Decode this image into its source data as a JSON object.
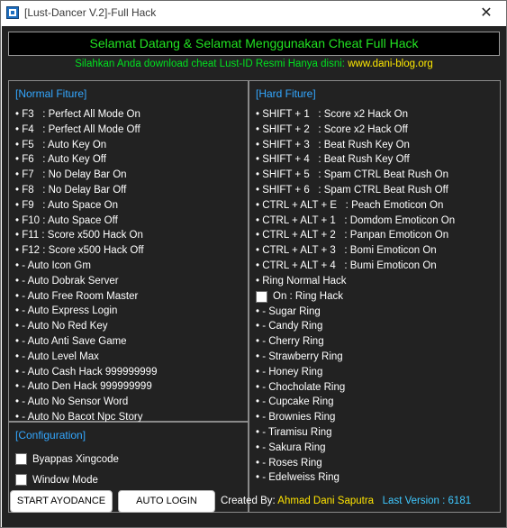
{
  "window": {
    "title": "[Lust-Dancer V.2]-Full Hack",
    "close_symbol": "✕"
  },
  "banner": {
    "text": "Selamat Datang & Selamat Menggunakan Cheat Full Hack"
  },
  "subline": {
    "text": "Silahkan Anda download cheat Lust-ID Resmi Hanya disni: ",
    "site": "www.dani-blog.org"
  },
  "normal": {
    "heading": "[Normal Fiture]",
    "items": [
      "• F3   : Perfect All Mode On",
      "• F4   : Perfect All Mode Off",
      "• F5   : Auto Key On",
      "• F6   : Auto Key Off",
      "• F7   : No Delay Bar On",
      "• F8   : No Delay Bar Off",
      "• F9   : Auto Space On",
      "• F10 : Auto Space Off",
      "• F11 : Score x500 Hack On",
      "• F12 : Score x500 Hack Off",
      "• - Auto Icon Gm",
      "• - Auto Dobrak Server",
      "• - Auto Free Room Master",
      "• - Auto Express Login",
      "• - Auto No Red Key",
      "• - Auto Anti Save Game",
      "• - Auto Level Max",
      "• - Auto Cash Hack 999999999",
      "• - Auto Den Hack 999999999",
      "• - Auto No Sensor Word",
      "• - Auto No Bacot Npc Story"
    ]
  },
  "hard": {
    "heading": "[Hard Fiture]",
    "items_top": [
      "• SHIFT + 1   : Score x2 Hack On",
      "• SHIFT + 2   : Score x2 Hack Off",
      "• SHIFT + 3   : Beat Rush Key On",
      "• SHIFT + 4   : Beat Rush Key Off",
      "• SHIFT + 5   : Spam CTRL Beat Rush On",
      "• SHIFT + 6   : Spam CTRL Beat Rush Off",
      "• CTRL + ALT + E   : Peach Emoticon On",
      "• CTRL + ALT + 1   : Domdom Emoticon On",
      "• CTRL + ALT + 2   : Panpan Emoticon On",
      "• CTRL + ALT + 3   : Bomi Emoticon On",
      "• CTRL + ALT + 4   : Bumi Emoticon On",
      "• Ring Normal Hack"
    ],
    "ring_hack_label": "On : Ring Hack",
    "rings": [
      "• - Sugar Ring",
      "• - Candy Ring",
      "• - Cherry Ring",
      "• - Strawberry Ring",
      "• - Honey Ring",
      "• - Chocholate Ring",
      "• - Cupcake Ring",
      "• - Brownies Ring",
      "• - Tiramisu Ring",
      "• - Sakura Ring",
      "• - Roses Ring",
      "• - Edelweiss Ring"
    ]
  },
  "config": {
    "heading": "[Configuration]",
    "bypass_label": "Byappas Xingcode",
    "window_mode_label": "Window Mode"
  },
  "buttons": {
    "start": "START AYODANCE",
    "login": "AUTO LOGIN"
  },
  "footer": {
    "created_prefix": "Created By: ",
    "author": "Ahmad Dani Saputra",
    "version": "Last Version : 6181"
  },
  "colors": {
    "background": "#222222",
    "green": "#22e322",
    "yellow": "#ffe400",
    "blue": "#33a7ff"
  },
  "icons": {
    "app": "app-icon",
    "close": "close-icon",
    "checkbox": "checkbox-icon"
  }
}
